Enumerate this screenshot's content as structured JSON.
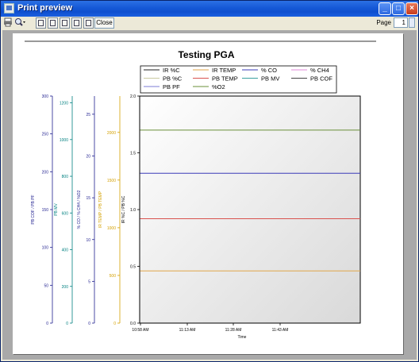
{
  "window": {
    "title": "Print preview"
  },
  "toolbar": {
    "close_label": "Close",
    "page_label": "Page",
    "page_value": "1"
  },
  "chart_data": {
    "type": "line",
    "title": "Testing PGA",
    "xlabel": "Time",
    "x_ticks": [
      "10:58 AM",
      "11:13 AM",
      "11:28 AM",
      "11:43 AM"
    ],
    "legend": [
      "IR %C",
      "IR TEMP",
      "% CO",
      "% CH4",
      "PB %C",
      "PB TEMP",
      "PB MV",
      "PB COF",
      "PB PF",
      "%O2"
    ],
    "axes": [
      {
        "label": "PB COF / PB PF",
        "ticks": [
          "0",
          "50",
          "100",
          "150",
          "200",
          "250",
          "300"
        ],
        "color": "#1f1f8f"
      },
      {
        "label": "PB MV",
        "ticks": [
          "0",
          "200",
          "400",
          "600",
          "800",
          "1000",
          "1200"
        ],
        "color": "#008080"
      },
      {
        "label": "% CO / % CH4 / %O2",
        "ticks": [
          "0",
          "5",
          "10",
          "15",
          "20",
          "25"
        ],
        "color": "#1f1f8f"
      },
      {
        "label": "IR TEMP / PB TEMP",
        "ticks": [
          "0",
          "500",
          "1000",
          "1500",
          "2000"
        ],
        "color": "#d4a000"
      },
      {
        "label": "IR %C / PB %C",
        "ticks": [
          "0.0",
          "0.5",
          "1.0",
          "1.5",
          "2.0"
        ],
        "color": "#000000"
      }
    ],
    "ylim_main": [
      0,
      2.0
    ],
    "series": [
      {
        "name": "%O2",
        "color": "#6a8f3a",
        "value": 1.7
      },
      {
        "name": "% CO",
        "color": "#3b3bb8",
        "value": 1.32
      },
      {
        "name": "PB TEMP",
        "color": "#d9534f",
        "value": 0.92
      },
      {
        "name": "IR TEMP",
        "color": "#e0a64a",
        "value": 0.46
      }
    ]
  }
}
